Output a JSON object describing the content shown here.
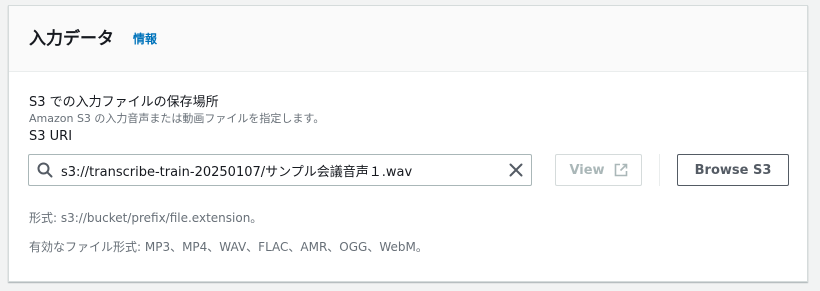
{
  "panel": {
    "title": "入力データ",
    "info_link": "情報"
  },
  "field": {
    "label": "S3 での入力ファイルの保存場所",
    "description": "Amazon S3 の入力音声または動画ファイルを指定します。",
    "uri_label": "S3 URI",
    "uri_value": "s3://transcribe-train-20250107/サンプル会議音声１.wav",
    "search_icon": "search-icon",
    "clear_icon": "close-icon"
  },
  "buttons": {
    "view_label": "View",
    "view_icon": "external-link-icon",
    "browse_label": "Browse S3"
  },
  "constraints": {
    "format": "形式: s3://bucket/prefix/file.extension。",
    "valid_formats": "有効なファイル形式: MP3、MP4、WAV、FLAC、AMR、OGG、WebM。"
  },
  "colors": {
    "link": "#0073bb",
    "text": "#16191f",
    "secondary_text": "#687078",
    "disabled": "#aab7b8",
    "button_border": "#545b64"
  }
}
